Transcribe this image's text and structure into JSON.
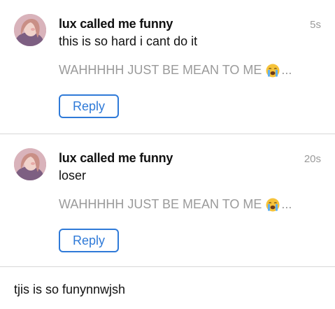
{
  "notifications": [
    {
      "sender": "lux called me funny",
      "time": "5s",
      "message": "this is so hard i cant do it",
      "quoted": "WAHHHHH JUST BE MEAN TO ME",
      "quoted_emoji": "crying-face-emoji",
      "ellipsis": "...",
      "reply_label": "Reply"
    },
    {
      "sender": "lux called me funny",
      "time": "20s",
      "message": "loser",
      "quoted": "WAHHHHH JUST BE MEAN TO ME",
      "quoted_emoji": "crying-face-emoji",
      "ellipsis": "...",
      "reply_label": "Reply"
    }
  ],
  "composer": {
    "value": "tjis is so funynnwjsh"
  },
  "colors": {
    "accent": "#2f7ad8",
    "muted_text": "#9a9a9a",
    "divider": "#d7d7d7"
  }
}
